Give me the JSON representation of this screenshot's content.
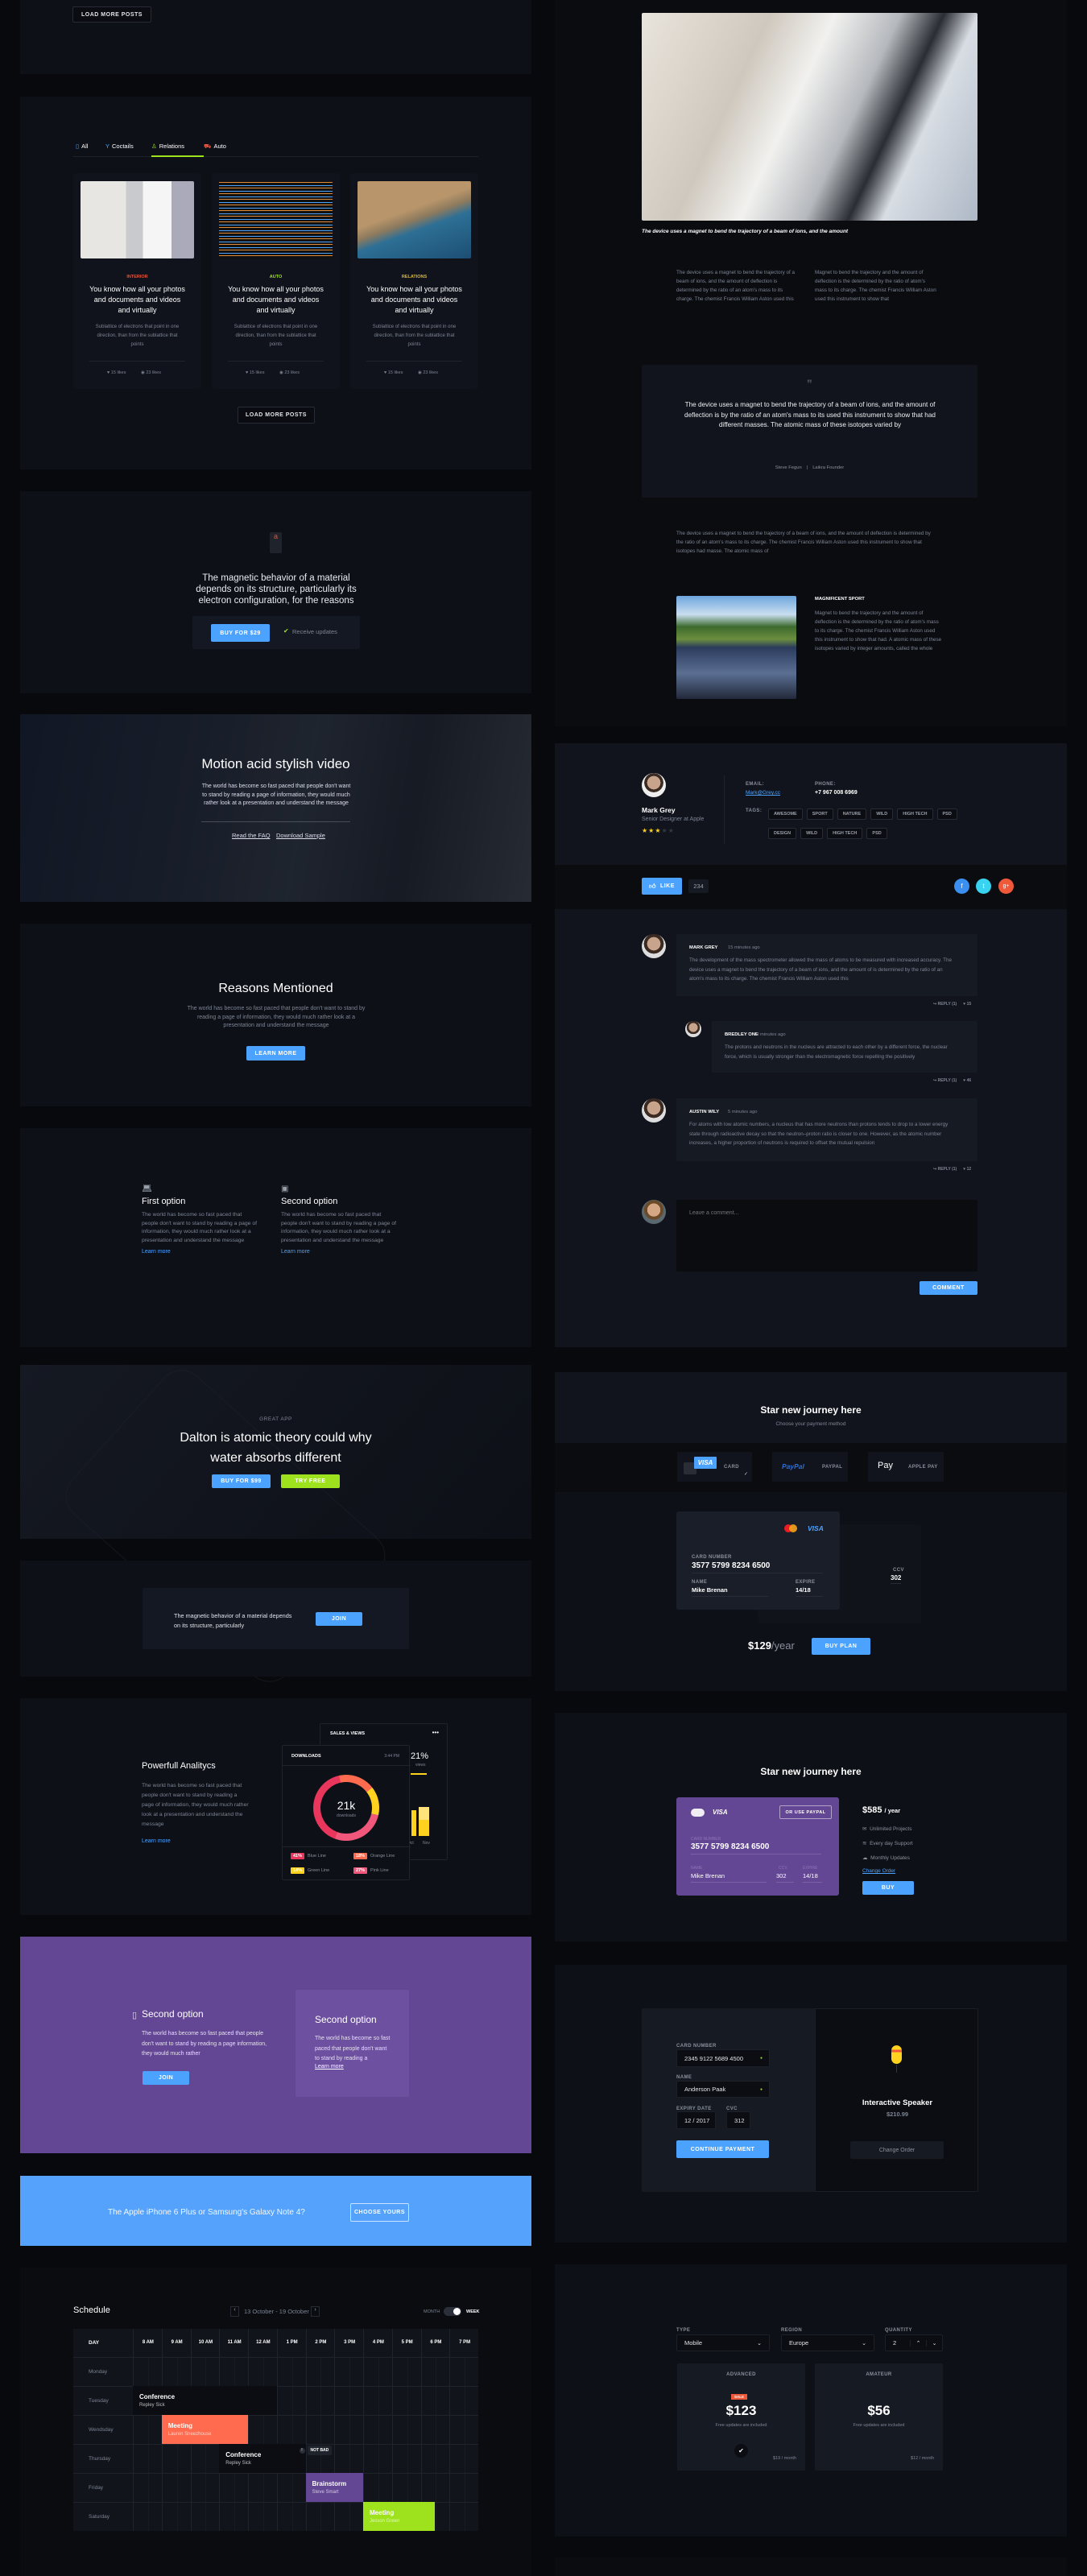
{
  "colors": {
    "accent": "#4ca3ff",
    "green": "#9ee21e",
    "purple": "#634694",
    "orange": "#ff6b4e"
  },
  "top_panel": {
    "load_more": "LOAD MORE POSTS"
  },
  "posts": {
    "tabs": [
      {
        "label": "All",
        "icon": "bookmark-icon"
      },
      {
        "label": "Coctails",
        "icon": "cocktail-icon"
      },
      {
        "label": "Relations",
        "icon": "person-icon",
        "active": true
      },
      {
        "label": "Auto",
        "icon": "car-icon"
      }
    ],
    "cards": [
      {
        "category": "INTERIOR",
        "category_color": "#e5533c",
        "title": "You know how all your photos and documents and videos and virtually",
        "desc": "Sublattice of electrons that point in one direction, than from the sublattice that points",
        "likes": "15 likes",
        "views": "23 likes"
      },
      {
        "category": "AUTO",
        "category_color": "#9ee21e",
        "title": "You know how all your photos and documents and videos and virtually",
        "desc": "Sublattice of electrons that point in one direction, than from the sublattice that points",
        "likes": "15 likes",
        "views": "23 likes"
      },
      {
        "category": "RELATIONS",
        "category_color": "#e5b81e",
        "title": "You know how all your photos and documents and videos and virtually",
        "desc": "Sublattice of electrons that point in one direction, than from the sublattice that points",
        "likes": "15 likes",
        "views": "23 likes"
      }
    ],
    "load_more": "LOAD MORE POSTS"
  },
  "buy_panel": {
    "text": "The magnetic behavior of a material depends on its structure, particularly its electron configuration, for the reasons",
    "button": "BUY FOR $29",
    "checkbox_label": "Receive updates",
    "checked": true
  },
  "video": {
    "title": "Motion acid stylish video",
    "desc": "The world has become so fast paced that people don't want to stand by reading a page of information, they would much rather look at a presentation and understand the message",
    "link1": "Read the FAQ",
    "link2": "Download Sample"
  },
  "reasons": {
    "title": "Reasons Mentioned",
    "desc": "The world has become so fast paced that people don't want to stand by reading a page of information, they would much rather look at a presentation and understand the message",
    "button": "LEARN MORE"
  },
  "options": [
    {
      "title": "First option",
      "desc": "The world has become so fast paced that people don't want to stand by reading a page of information, they would much rather look at a presentation and understand the message",
      "link": "Learn more",
      "icon": "laptop-icon"
    },
    {
      "title": "Second option",
      "desc": "The world has become so fast paced that people don't want to stand by reading a page of information, they would much rather look at a presentation and understand the message",
      "link": "Learn more",
      "icon": "tablet-icon"
    }
  ],
  "app_hero": {
    "eyebrow": "GREAT APP",
    "title": "Dalton is atomic theory could why water absorbs different",
    "buy": "BUY FOR $99",
    "try": "TRY FREE"
  },
  "newsletter": {
    "text": "The magnetic behavior of a material depends on its structure, particularly",
    "button": "JOIN"
  },
  "analytics": {
    "title": "Powerfull Analitycs",
    "desc": "The world has become so fast paced that people don't want to stand by reading a page of information, they would much rather look at a presentation and understand the message",
    "link": "Learn more",
    "sales_title": "SALES & VIEWS",
    "sales_pct": "21%",
    "sales_sub": "views",
    "sales_months": [
      "Oct",
      "Nov"
    ],
    "downloads_title": "DOWNLOADS",
    "time": "3:44 PM",
    "center_value": "21k",
    "center_label": "downloads",
    "segments": [
      {
        "pct": 41,
        "label": "Blue Line",
        "color": "#e8365d"
      },
      {
        "pct": 18,
        "label": "Orange Line",
        "color": "#ff6b4e"
      },
      {
        "pct": 14,
        "label": "Green Line",
        "color": "#ffd21f"
      },
      {
        "pct": 27,
        "label": "Pink Line",
        "color": "#f0577a"
      }
    ]
  },
  "purple": {
    "col1_title": "Second option",
    "col1_desc": "The world has become so fast paced that people don't want to stand by reading a page information, they would much rather",
    "join": "JOIN",
    "col2_title": "Second option",
    "col2_desc": "The world has become so fast paced that people don't want to stand by reading a",
    "col2_link": "Learn more"
  },
  "cta": {
    "text": "The Apple iPhone 6 Plus or Samsung's Galaxy Note 4?",
    "button": "CHOOSE YOURS"
  },
  "schedule": {
    "title": "Schedule",
    "range": "13 October - 19 October",
    "toggle_left": "MONTH",
    "toggle_right": "WEEK",
    "toggle_on": "week",
    "day_header": "DAY",
    "hours": [
      "8 AM",
      "9 AM",
      "10 AM",
      "11 AM",
      "12 AM",
      "1 PM",
      "2 PM",
      "3 PM",
      "4 PM",
      "5 PM",
      "6 PM",
      "7 PM"
    ],
    "days": [
      "Monday",
      "Tuesday",
      "Wendsday",
      "Thursday",
      "Friday",
      "Saturday"
    ],
    "events": [
      {
        "title": "Conference",
        "person": "Repley Sick",
        "day": 1,
        "start": 8,
        "end": 13,
        "color": "#0b0d12"
      },
      {
        "title": "Meeting",
        "person": "Lauren Sneezhouse",
        "day": 2,
        "start": 9,
        "end": 12,
        "color": "#ff6b4e"
      },
      {
        "title": "Conference",
        "person": "Repley Sick",
        "day": 3,
        "start": 11,
        "end": 14,
        "color": "#0b0d12",
        "badge": "NOT BAD"
      },
      {
        "title": "Brainstorm",
        "person": "Steve Smart",
        "day": 4,
        "start": 14,
        "end": 16,
        "color": "#634694"
      },
      {
        "title": "Meeting",
        "person": "Jesson Green",
        "day": 5,
        "start": 16,
        "end": 18.5,
        "color": "#9ee21e"
      }
    ]
  },
  "article": {
    "caption": "The device uses a magnet to bend the trajectory of a beam of ions, and the amount",
    "col1": "The device uses a magnet to bend the trajectory of a beam of ions, and the amount of deflection is determined by the ratio of an atom's mass to its charge. The chemist Francis William Aston used this",
    "col2": "Magnet to bend the trajectory and the amount of deflection is the determined by the ratio of atom's mass to its charge. The chemist Francis William Aston used this instrument to show that",
    "quote": "The device uses a magnet to bend the trajectory of a beam of ions, and the amount of deflection is  by the ratio of an atom's mass to its  used this instrument to show that  had different masses. The atomic mass of these isotopes varied by",
    "quote_author": "Steve Fegun",
    "quote_role": "Laikra Founder",
    "para": "The device uses a magnet to bend the trajectory of a beam of ions, and the amount of deflection is determined by the ratio of an atom's mass to its charge. The chemist Francis William Aston used this instrument to show that isotopes had masse. The atomic mass of",
    "side_title": "MAGNIFICENT SPORT",
    "side_text": "Magnet to bend the trajectory and the amount of deflection is the determined by the ratio of atom's mass to its charge. The chemist Francis William Aston used this instrument to show that had. A atomic mass of these isotopes varied by integer amounts, called the whole"
  },
  "profile": {
    "name": "Mark Grey",
    "role": "Senior Designer at Apple",
    "rating": 3,
    "email_label": "EMAIL:",
    "email": "Mark@Grey.cc",
    "phone_label": "PHONE:",
    "phone": "+7 967 008 6969",
    "tags_label": "TAGS:",
    "tags": [
      "AWESOME",
      "SPORT",
      "NATURE",
      "WILD",
      "HIGH TECH",
      "PSD",
      "DESIGN",
      "WILD",
      "HIGH TECH",
      "PSD"
    ],
    "like": "LIKE",
    "like_count": "234"
  },
  "comments": [
    {
      "name": "MARK GREY",
      "time": "15 minutes ago",
      "text": "The development of the mass spectrometer allowed the mass of atoms to be measured with increased accuracy. The device uses a magnet to bend the trajectory of a beam of ions, and the amount of  is determined by the ratio of an atom's mass to its charge. The chemist Francis William Aston used this",
      "reply": "REPLY (1)",
      "likes": "15"
    },
    {
      "name": "BREDLEY ONE",
      "time": "10 minutes ago",
      "text": "The protons and neutrons in the nucleus are attracted to each other by a different force, the nuclear force, which is usually stronger than the electromagnetic force repelling the positively",
      "reply": "REPLY (1)",
      "likes": "46"
    },
    {
      "name": "AUSTIN WILY",
      "time": "5 minutes ago",
      "text": "For atoms with low atomic numbers, a nucleus that has more neutrons than protons tends to drop to a lower energy state through radioactive decay so that the neutron–proton ratio is closer to one. However, as the atomic number increases, a higher proportion of neutrons is required to offset the mutual repulsion",
      "reply": "REPLY (1)",
      "likes": "12"
    }
  ],
  "comment_form": {
    "placeholder": "Leave a comment...",
    "button": "COMMENT"
  },
  "payment1": {
    "title": "Star new journey here",
    "subtitle": "Choose your payment method",
    "methods": [
      {
        "logo": "VISA",
        "label": "CARD",
        "selected": true
      },
      {
        "logo": "PayPal",
        "label": "PAYPAL"
      },
      {
        "logo": "Pay",
        "label": "APPLE PAY"
      }
    ],
    "card_brand": "VISA",
    "card_number_label": "CARD NUMBER",
    "card_number": "3577 5799 8234 6500",
    "name_label": "NAME",
    "name": "Mike Brenan",
    "expire_label": "EXPIRE",
    "expire": "14/18",
    "ccv_label": "CCV",
    "ccv": "302",
    "price": "$129",
    "period": "/year",
    "button": "BUY PLAN"
  },
  "payment2": {
    "title": "Star new journey here",
    "brand": "VISA",
    "paypal": "OR USE PAYPAL",
    "card_number_label": "CARD NUMBER",
    "card_number": "3577 5799 8234 6500",
    "name_label": "NAME",
    "name": "Mike Brenan",
    "ccv_label": "CCV",
    "ccv": "302",
    "expire_label": "EXPIRE",
    "expire": "14/18",
    "price": "$585",
    "period": "/ year",
    "features": [
      {
        "icon": "mail-icon",
        "text": "Unlimited Projects"
      },
      {
        "icon": "wifi-icon",
        "text": "Every day Support"
      },
      {
        "icon": "cloud-icon",
        "text": "Monthly Updates"
      }
    ],
    "change": "Change Order",
    "button": "BUY"
  },
  "checkout": {
    "card_label": "CARD NUMBER",
    "card": "2345 9122 5689 4500",
    "name_label": "NAME",
    "name": "Anderson Paak",
    "expiry_label": "EXPIRY DATE",
    "expiry": "12 / 2017",
    "cvc_label": "CVC",
    "cvc": "312",
    "button": "CONTINUE PAYMENT",
    "product": "Interactive Speaker",
    "price": "$210.99",
    "change": "Change Order"
  },
  "pricing": {
    "type_label": "TYPE",
    "type": "Mobile",
    "region_label": "REGION",
    "region": "Europe",
    "qty_label": "QUANTITY",
    "qty": "2",
    "plans": [
      {
        "name": "ADVANCED",
        "badge": "SALE",
        "price": "$123",
        "sub": "Free updates are included",
        "monthly": "$19 / month",
        "selected": true
      },
      {
        "name": "AMATEUR",
        "price": "$56",
        "sub": "Free updates are included",
        "monthly": "$12 / month"
      }
    ]
  }
}
